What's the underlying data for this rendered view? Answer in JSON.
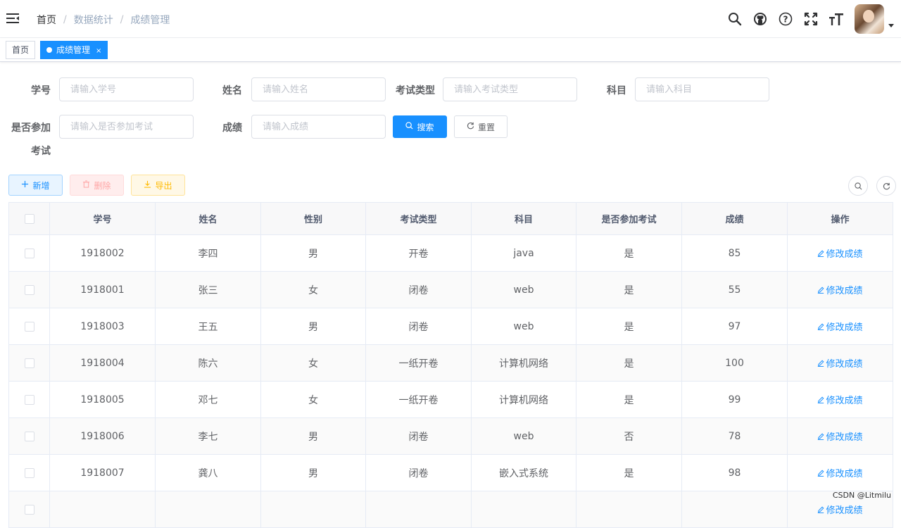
{
  "breadcrumb": [
    "首页",
    "数据统计",
    "成绩管理"
  ],
  "header_icons": [
    "search-icon",
    "github-icon",
    "question-icon",
    "fullscreen-icon",
    "text-size-icon"
  ],
  "tags": [
    {
      "label": "首页",
      "active": false
    },
    {
      "label": "成绩管理",
      "active": true,
      "close": "×"
    }
  ],
  "form": {
    "student_id": {
      "label": "学号",
      "placeholder": "请输入学号"
    },
    "name": {
      "label": "姓名",
      "placeholder": "请输入姓名"
    },
    "exam_type": {
      "label": "考试类型",
      "placeholder": "请输入考试类型"
    },
    "subject": {
      "label": "科目",
      "placeholder": "请输入科目"
    },
    "attended": {
      "label_line1": "是否参加",
      "label_line2": "考试",
      "placeholder": "请输入是否参加考试"
    },
    "score": {
      "label": "成绩",
      "placeholder": "请输入成绩"
    },
    "search_label": "搜索",
    "reset_label": "重置"
  },
  "toolbar": {
    "add_label": "新增",
    "delete_label": "删除",
    "export_label": "导出"
  },
  "table": {
    "columns": [
      "学号",
      "姓名",
      "性别",
      "考试类型",
      "科目",
      "是否参加考试",
      "成绩",
      "操作"
    ],
    "action_label": "修改成绩",
    "rows": [
      [
        "1918002",
        "李四",
        "男",
        "开卷",
        "java",
        "是",
        "85"
      ],
      [
        "1918001",
        "张三",
        "女",
        "闭卷",
        "web",
        "是",
        "55"
      ],
      [
        "1918003",
        "王五",
        "男",
        "闭卷",
        "web",
        "是",
        "97"
      ],
      [
        "1918004",
        "陈六",
        "女",
        "一纸开卷",
        "计算机网络",
        "是",
        "100"
      ],
      [
        "1918005",
        "邓七",
        "女",
        "一纸开卷",
        "计算机网络",
        "是",
        "99"
      ],
      [
        "1918006",
        "李七",
        "男",
        "闭卷",
        "web",
        "否",
        "78"
      ],
      [
        "1918007",
        "龚八",
        "男",
        "闭卷",
        "嵌入式系统",
        "是",
        "98"
      ],
      [
        "",
        "",
        "",
        "",
        "",
        "",
        ""
      ]
    ]
  },
  "watermark": "CSDN @Litmilu",
  "colors": {
    "primary": "#1890ff",
    "danger": "#ff4949",
    "warning": "#ffba00"
  }
}
